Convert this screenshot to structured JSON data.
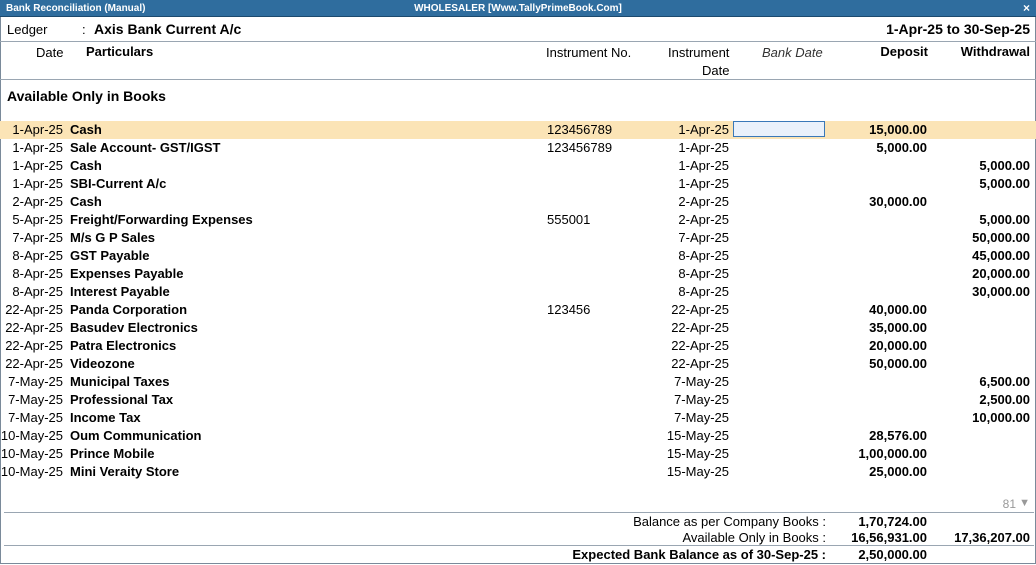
{
  "window": {
    "title": "Bank Reconciliation (Manual)",
    "company": "WHOLESALER [Www.TallyPrimeBook.Com]",
    "close_symbol": "×"
  },
  "ledger": {
    "label": "Ledger",
    "colon": ":",
    "name": "Axis Bank Current A/c",
    "period": "1-Apr-25 to 30-Sep-25"
  },
  "columns": {
    "date": "Date",
    "particulars": "Particulars",
    "instrument_no": "Instrument No.",
    "instrument_date_line1": "Instrument",
    "instrument_date_line2": "Date",
    "bank_date": "Bank Date",
    "deposit": "Deposit",
    "withdrawal": "Withdrawal"
  },
  "section_title": "Available Only in Books",
  "rows": [
    {
      "date": "1-Apr-25",
      "particulars": "Cash",
      "instrument_no": "123456789",
      "instrument_date": "1-Apr-25",
      "deposit": "15,000.00",
      "withdrawal": ""
    },
    {
      "date": "1-Apr-25",
      "particulars": "Sale Account- GST/IGST",
      "instrument_no": "123456789",
      "instrument_date": "1-Apr-25",
      "deposit": "5,000.00",
      "withdrawal": ""
    },
    {
      "date": "1-Apr-25",
      "particulars": "Cash",
      "instrument_no": "",
      "instrument_date": "1-Apr-25",
      "deposit": "",
      "withdrawal": "5,000.00"
    },
    {
      "date": "1-Apr-25",
      "particulars": "SBI-Current A/c",
      "instrument_no": "",
      "instrument_date": "1-Apr-25",
      "deposit": "",
      "withdrawal": "5,000.00"
    },
    {
      "date": "2-Apr-25",
      "particulars": "Cash",
      "instrument_no": "",
      "instrument_date": "2-Apr-25",
      "deposit": "30,000.00",
      "withdrawal": ""
    },
    {
      "date": "5-Apr-25",
      "particulars": "Freight/Forwarding Expenses",
      "instrument_no": "555001",
      "instrument_date": "2-Apr-25",
      "deposit": "",
      "withdrawal": "5,000.00"
    },
    {
      "date": "7-Apr-25",
      "particulars": "M/s G P Sales",
      "instrument_no": "",
      "instrument_date": "7-Apr-25",
      "deposit": "",
      "withdrawal": "50,000.00"
    },
    {
      "date": "8-Apr-25",
      "particulars": "GST Payable",
      "instrument_no": "",
      "instrument_date": "8-Apr-25",
      "deposit": "",
      "withdrawal": "45,000.00"
    },
    {
      "date": "8-Apr-25",
      "particulars": "Expenses Payable",
      "instrument_no": "",
      "instrument_date": "8-Apr-25",
      "deposit": "",
      "withdrawal": "20,000.00"
    },
    {
      "date": "8-Apr-25",
      "particulars": "Interest Payable",
      "instrument_no": "",
      "instrument_date": "8-Apr-25",
      "deposit": "",
      "withdrawal": "30,000.00"
    },
    {
      "date": "22-Apr-25",
      "particulars": "Panda Corporation",
      "instrument_no": "123456",
      "instrument_date": "22-Apr-25",
      "deposit": "40,000.00",
      "withdrawal": ""
    },
    {
      "date": "22-Apr-25",
      "particulars": "Basudev Electronics",
      "instrument_no": "",
      "instrument_date": "22-Apr-25",
      "deposit": "35,000.00",
      "withdrawal": ""
    },
    {
      "date": "22-Apr-25",
      "particulars": "Patra Electronics",
      "instrument_no": "",
      "instrument_date": "22-Apr-25",
      "deposit": "20,000.00",
      "withdrawal": ""
    },
    {
      "date": "22-Apr-25",
      "particulars": "Videozone",
      "instrument_no": "",
      "instrument_date": "22-Apr-25",
      "deposit": "50,000.00",
      "withdrawal": ""
    },
    {
      "date": "7-May-25",
      "particulars": "Municipal Taxes",
      "instrument_no": "",
      "instrument_date": "7-May-25",
      "deposit": "",
      "withdrawal": "6,500.00"
    },
    {
      "date": "7-May-25",
      "particulars": "Professional Tax",
      "instrument_no": "",
      "instrument_date": "7-May-25",
      "deposit": "",
      "withdrawal": "2,500.00"
    },
    {
      "date": "7-May-25",
      "particulars": "Income Tax",
      "instrument_no": "",
      "instrument_date": "7-May-25",
      "deposit": "",
      "withdrawal": "10,000.00"
    },
    {
      "date": "10-May-25",
      "particulars": "Oum Communication",
      "instrument_no": "",
      "instrument_date": "15-May-25",
      "deposit": "28,576.00",
      "withdrawal": ""
    },
    {
      "date": "10-May-25",
      "particulars": "Prince Mobile",
      "instrument_no": "",
      "instrument_date": "15-May-25",
      "deposit": "1,00,000.00",
      "withdrawal": ""
    },
    {
      "date": "10-May-25",
      "particulars": "Mini Veraity Store",
      "instrument_no": "",
      "instrument_date": "15-May-25",
      "deposit": "25,000.00",
      "withdrawal": ""
    }
  ],
  "pager": {
    "count": "81",
    "icon": "▼"
  },
  "footer": {
    "balance_company_label": "Balance as per Company Books :",
    "balance_company_deposit": "1,70,724.00",
    "available_books_label": "Available Only in Books :",
    "available_books_deposit": "16,56,931.00",
    "available_books_withdrawal": "17,36,207.00",
    "expected_label": "Expected Bank Balance as of 30-Sep-25 :",
    "expected_deposit": "2,50,000.00"
  }
}
